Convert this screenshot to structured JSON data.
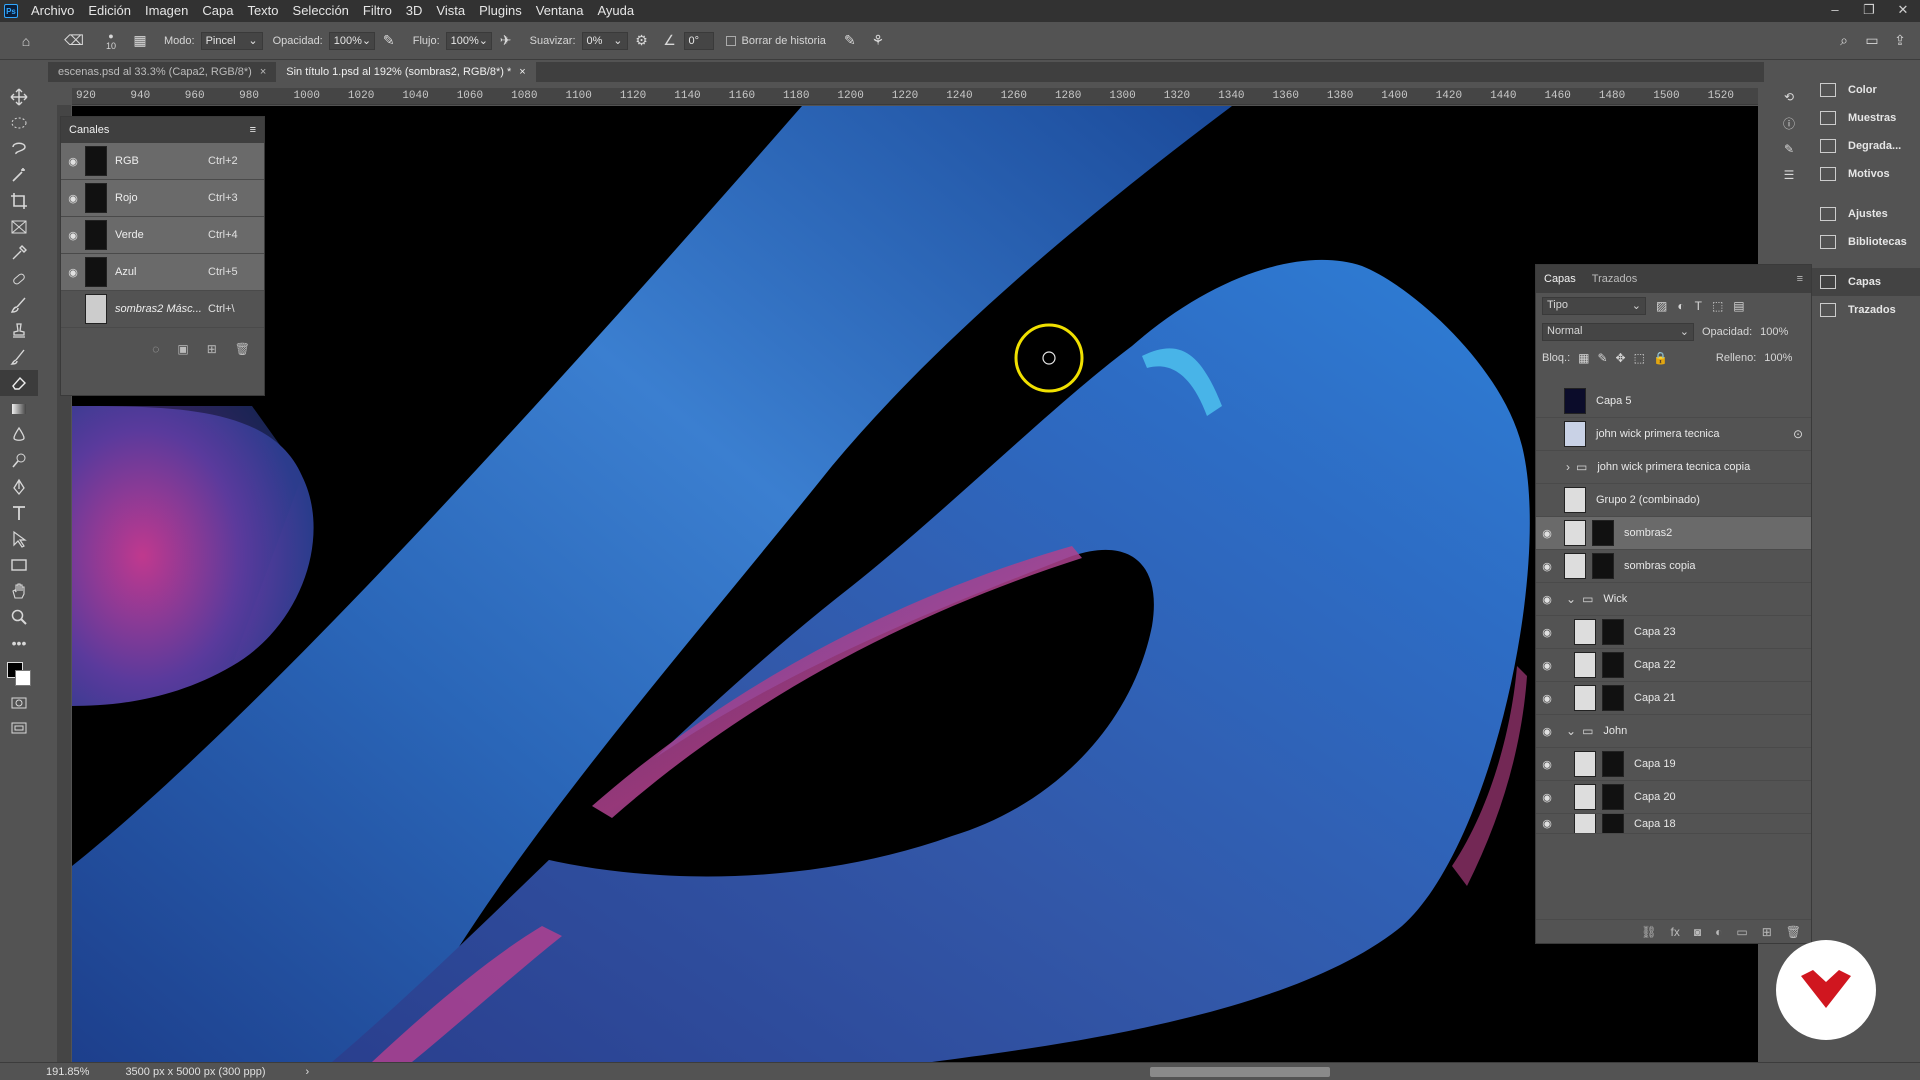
{
  "menu": [
    "Archivo",
    "Edición",
    "Imagen",
    "Capa",
    "Texto",
    "Selección",
    "Filtro",
    "3D",
    "Vista",
    "Plugins",
    "Ventana",
    "Ayuda"
  ],
  "options": {
    "brush_size": "10",
    "mode_label": "Modo:",
    "mode_value": "Pincel",
    "opacity_label": "Opacidad:",
    "opacity_value": "100%",
    "flow_label": "Flujo:",
    "flow_value": "100%",
    "smoothing_label": "Suavizar:",
    "smoothing_value": "0%",
    "angle_value": "0°",
    "erase_history": "Borrar de historia"
  },
  "tabs": [
    {
      "label": "escenas.psd al 33.3% (Capa2, RGB/8*)"
    },
    {
      "label": "Sin título 1.psd al 192% (sombras2, RGB/8*) *"
    }
  ],
  "ruler_ticks": [
    "920",
    "940",
    "960",
    "980",
    "1000",
    "1020",
    "1040",
    "1060",
    "1080",
    "1100",
    "1120",
    "1140",
    "1160",
    "1180",
    "1200",
    "1220",
    "1240",
    "1260",
    "1280",
    "1300",
    "1320",
    "1340",
    "1360",
    "1380",
    "1400",
    "1420",
    "1440",
    "1460",
    "1480",
    "1500",
    "1520"
  ],
  "channels": {
    "title": "Canales",
    "rows": [
      {
        "name": "RGB",
        "key": "Ctrl+2"
      },
      {
        "name": "Rojo",
        "key": "Ctrl+3"
      },
      {
        "name": "Verde",
        "key": "Ctrl+4"
      },
      {
        "name": "Azul",
        "key": "Ctrl+5"
      },
      {
        "name": "sombras2 Másc...",
        "key": "Ctrl+\\"
      }
    ]
  },
  "layers": {
    "tab_active": "Capas",
    "tab_other": "Trazados",
    "filter": "Tipo",
    "blend_mode": "Normal",
    "opacity_label": "Opacidad:",
    "opacity_value": "100%",
    "lock_label": "Bloq.:",
    "fill_label": "Relleno:",
    "fill_value": "100%",
    "rows": [
      {
        "name": "Capa 5"
      },
      {
        "name": "john wick primera tecnica"
      },
      {
        "name": "john wick primera tecnica copia"
      },
      {
        "name": "Grupo 2 (combinado)"
      },
      {
        "name": "sombras2"
      },
      {
        "name": "sombras copia"
      },
      {
        "name": "Wick"
      },
      {
        "name": "Capa 23"
      },
      {
        "name": "Capa 22"
      },
      {
        "name": "Capa 21"
      },
      {
        "name": "John"
      },
      {
        "name": "Capa 19"
      },
      {
        "name": "Capa 20"
      },
      {
        "name": "Capa 18"
      }
    ]
  },
  "right_panel": [
    "Color",
    "Muestras",
    "Degrada...",
    "Motivos",
    "Ajustes",
    "Bibliotecas",
    "Capas",
    "Trazados"
  ],
  "status": {
    "zoom": "191.85%",
    "doc_info": "3500 px x 5000 px (300 ppp)"
  }
}
